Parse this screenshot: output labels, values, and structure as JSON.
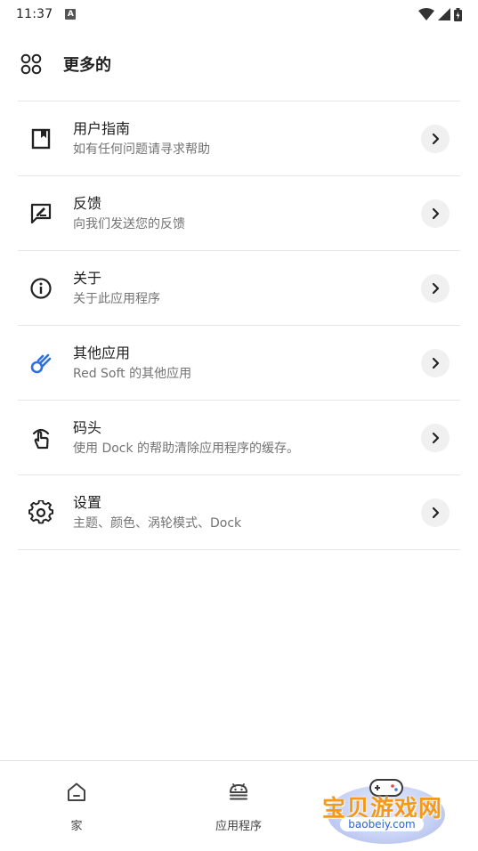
{
  "status_bar": {
    "time": "11:37",
    "notification_letter": "A"
  },
  "header": {
    "title": "更多的"
  },
  "menu": {
    "items": [
      {
        "title": "用户指南",
        "subtitle": "如有任何问题请寻求帮助",
        "icon": "book-icon"
      },
      {
        "title": "反馈",
        "subtitle": "向我们发送您的反馈",
        "icon": "feedback-icon"
      },
      {
        "title": "关于",
        "subtitle": "关于此应用程序",
        "icon": "info-icon"
      },
      {
        "title": "其他应用",
        "subtitle": "Red Soft 的其他应用",
        "icon": "comet-icon"
      },
      {
        "title": "码头",
        "subtitle": "使用 Dock 的帮助清除应用程序的缓存。",
        "icon": "touch-icon"
      },
      {
        "title": "设置",
        "subtitle": "主题、颜色、涡轮模式、Dock",
        "icon": "gear-icon"
      }
    ]
  },
  "bottom_nav": {
    "items": [
      {
        "label": "家",
        "icon": "home-icon"
      },
      {
        "label": "应用程序",
        "icon": "android-icon"
      }
    ]
  },
  "watermark": {
    "text": "宝贝游戏网",
    "url": "baobeiy.com"
  },
  "colors": {
    "accent_blue": "#2f6fde",
    "text_primary": "#1e1e1e",
    "text_secondary": "#737373",
    "divider": "#e6e6e6",
    "chevron_bg": "#f0f0f0"
  }
}
